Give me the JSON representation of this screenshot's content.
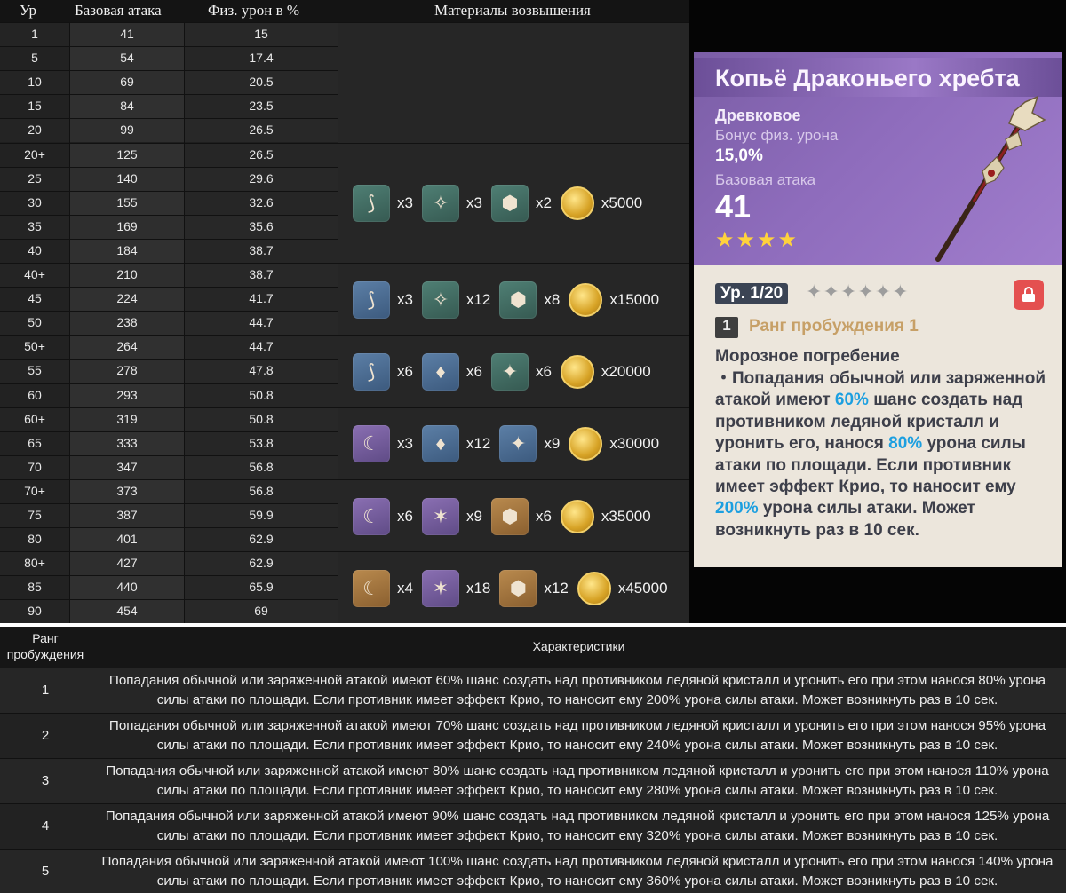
{
  "stats_table": {
    "headers": {
      "level": "Ур",
      "base_atk": "Базовая атака",
      "phys_dmg": "Физ. урон в %",
      "materials": "Материалы возвышения"
    },
    "rows": [
      {
        "level": "1",
        "base_atk": "41",
        "phys": "15"
      },
      {
        "level": "5",
        "base_atk": "54",
        "phys": "17.4"
      },
      {
        "level": "10",
        "base_atk": "69",
        "phys": "20.5"
      },
      {
        "level": "15",
        "base_atk": "84",
        "phys": "23.5"
      },
      {
        "level": "20",
        "base_atk": "99",
        "phys": "26.5"
      },
      {
        "level": "20+",
        "base_atk": "125",
        "phys": "26.5"
      },
      {
        "level": "25",
        "base_atk": "140",
        "phys": "29.6"
      },
      {
        "level": "30",
        "base_atk": "155",
        "phys": "32.6"
      },
      {
        "level": "35",
        "base_atk": "169",
        "phys": "35.6"
      },
      {
        "level": "40",
        "base_atk": "184",
        "phys": "38.7"
      },
      {
        "level": "40+",
        "base_atk": "210",
        "phys": "38.7"
      },
      {
        "level": "45",
        "base_atk": "224",
        "phys": "41.7"
      },
      {
        "level": "50",
        "base_atk": "238",
        "phys": "44.7"
      },
      {
        "level": "50+",
        "base_atk": "264",
        "phys": "44.7"
      },
      {
        "level": "55",
        "base_atk": "278",
        "phys": "47.8"
      },
      {
        "level": "60",
        "base_atk": "293",
        "phys": "50.8"
      },
      {
        "level": "60+",
        "base_atk": "319",
        "phys": "50.8"
      },
      {
        "level": "65",
        "base_atk": "333",
        "phys": "53.8"
      },
      {
        "level": "70",
        "base_atk": "347",
        "phys": "56.8"
      },
      {
        "level": "70+",
        "base_atk": "373",
        "phys": "56.8"
      },
      {
        "level": "75",
        "base_atk": "387",
        "phys": "59.9"
      },
      {
        "level": "80",
        "base_atk": "401",
        "phys": "62.9"
      },
      {
        "level": "80+",
        "base_atk": "427",
        "phys": "62.9"
      },
      {
        "level": "85",
        "base_atk": "440",
        "phys": "65.9"
      },
      {
        "level": "90",
        "base_atk": "454",
        "phys": "69"
      }
    ],
    "ascension": [
      {
        "items": [
          {
            "icon": "horn-icon",
            "rarity": "green",
            "count": "x3"
          },
          {
            "icon": "crystal-shard-icon",
            "rarity": "green",
            "count": "x3"
          },
          {
            "icon": "insignia-icon",
            "rarity": "green",
            "count": "x2"
          }
        ],
        "mora": "x5000"
      },
      {
        "items": [
          {
            "icon": "horn-icon",
            "rarity": "blue",
            "count": "x3"
          },
          {
            "icon": "crystal-shard-icon",
            "rarity": "green",
            "count": "x12"
          },
          {
            "icon": "insignia-icon",
            "rarity": "green",
            "count": "x8"
          }
        ],
        "mora": "x15000"
      },
      {
        "items": [
          {
            "icon": "horn-icon",
            "rarity": "blue",
            "count": "x6"
          },
          {
            "icon": "pouch-icon",
            "rarity": "blue",
            "count": "x6"
          },
          {
            "icon": "star-badge-icon",
            "rarity": "green",
            "count": "x6"
          }
        ],
        "mora": "x20000"
      },
      {
        "items": [
          {
            "icon": "claw-icon",
            "rarity": "purple",
            "count": "x3"
          },
          {
            "icon": "pouch-icon",
            "rarity": "blue",
            "count": "x12"
          },
          {
            "icon": "star-badge-icon",
            "rarity": "blue",
            "count": "x9"
          }
        ],
        "mora": "x30000"
      },
      {
        "items": [
          {
            "icon": "claw-icon",
            "rarity": "purple",
            "count": "x6"
          },
          {
            "icon": "wand-icon",
            "rarity": "purple",
            "count": "x9"
          },
          {
            "icon": "insignia-icon",
            "rarity": "gold",
            "count": "x6"
          }
        ],
        "mora": "x35000"
      },
      {
        "items": [
          {
            "icon": "claw-icon",
            "rarity": "gold",
            "count": "x4"
          },
          {
            "icon": "wand-icon",
            "rarity": "purple",
            "count": "x18"
          },
          {
            "icon": "insignia-icon",
            "rarity": "gold",
            "count": "x12"
          }
        ],
        "mora": "x45000"
      }
    ]
  },
  "weapon_card": {
    "title": "Копьё Драконьего хребта",
    "type": "Древковое",
    "substat_label": "Бонус физ. урона",
    "substat_value": "15,0%",
    "base_atk_label": "Базовая атака",
    "base_atk_value": "41",
    "rarity_stars": 4,
    "level": "Ур. 1/20",
    "refinement_badge": "1",
    "refinement_label": "Ранг пробуждения 1",
    "passive_name": "Морозное погребение",
    "passive_parts": [
      {
        "text": "・Попадания обычной или заряженной атакой имеют ",
        "hl": false
      },
      {
        "text": "60%",
        "hl": true
      },
      {
        "text": " шанс создать над противником ледяной кристалл и уронить его, нанося ",
        "hl": false
      },
      {
        "text": "80%",
        "hl": true
      },
      {
        "text": " урона силы атаки по площади. Если противник имеет эффект Крио, то наносит ему ",
        "hl": false
      },
      {
        "text": "200%",
        "hl": true
      },
      {
        "text": " урона силы атаки. Может возникнуть раз в 10 сек.",
        "hl": false
      }
    ]
  },
  "refinement_table": {
    "headers": {
      "rank": "Ранг пробуждения",
      "characteristics": "Характеристики"
    },
    "rows": [
      {
        "rank": "1",
        "text": "Попадания обычной или заряженной атакой имеют 60% шанс создать над противником ледяной кристалл и уронить его при этом нанося 80% урона силы атаки по площади. Если противник имеет эффект Крио, то наносит ему 200% урона силы атаки. Может возникнуть раз в 10 сек."
      },
      {
        "rank": "2",
        "text": "Попадания обычной или заряженной атакой имеют 70% шанс создать над противником ледяной кристалл и уронить его при этом нанося 95% урона силы атаки по площади. Если противник имеет эффект Крио, то наносит ему 240% урона силы атаки. Может возникнуть раз в 10 сек."
      },
      {
        "rank": "3",
        "text": "Попадания обычной или заряженной атакой имеют 80% шанс создать над противником ледяной кристалл и уронить его при этом нанося 110% урона силы атаки по площади. Если противник имеет эффект Крио, то наносит ему 280% урона силы атаки. Может возникнуть раз в 10 сек."
      },
      {
        "rank": "4",
        "text": "Попадания обычной или заряженной атакой имеют 90% шанс создать над противником ледяной кристалл и уронить его при этом нанося 125% урона силы атаки по площади. Если противник имеет эффект Крио, то наносит ему 320% урона силы атаки. Может возникнуть раз в 10 сек."
      },
      {
        "rank": "5",
        "text": "Попадания обычной или заряженной атакой имеют 100% шанс создать над противником ледяной кристалл и уронить его при этом нанося 140% урона силы атаки по площади. Если противник имеет эффект Крио, то наносит ему 360% урона силы атаки. Может возникнуть раз в 10 сек."
      }
    ]
  }
}
